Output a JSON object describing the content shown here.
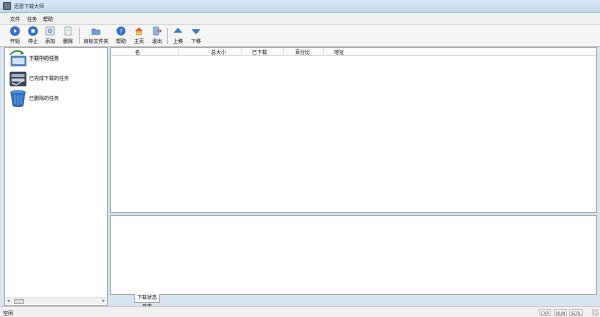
{
  "window": {
    "title": "迅雷下载大师"
  },
  "menu": [
    "文件",
    "任务",
    "帮助"
  ],
  "toolbar": [
    {
      "label": "开始",
      "icon": "start-icon"
    },
    {
      "label": "停止",
      "icon": "stop-icon"
    },
    {
      "label": "添加",
      "icon": "add-icon"
    },
    {
      "label": "删除",
      "icon": "delete-icon"
    },
    {
      "label": "目标文件夹",
      "icon": "folder-icon"
    },
    {
      "label": "帮助",
      "icon": "help-icon"
    },
    {
      "label": "主页",
      "icon": "home-icon"
    },
    {
      "label": "退出",
      "icon": "exit-icon"
    },
    {
      "label": "上移",
      "icon": "move-up-icon"
    },
    {
      "label": "下移",
      "icon": "move-down-icon"
    }
  ],
  "sidebar": {
    "items": [
      {
        "label": "下载中的任务",
        "icon": "downloading-icon"
      },
      {
        "label": "已完成下载的任务",
        "icon": "completed-icon"
      },
      {
        "label": "已删除的任务",
        "icon": "recycle-bin-icon"
      }
    ]
  },
  "table": {
    "columns": [
      "名",
      "总大小",
      "已下载",
      "百分比",
      "地址"
    ],
    "rows": []
  },
  "log": {
    "tab_label": "下载状态日志"
  },
  "status": {
    "text": "空闲",
    "indicators": [
      "CAP",
      "NUM",
      "SCRL"
    ]
  },
  "colors": {
    "accent": "#1c5fb8",
    "window_bg": "#d9e4f1",
    "chrome": "#f0f0f0"
  }
}
